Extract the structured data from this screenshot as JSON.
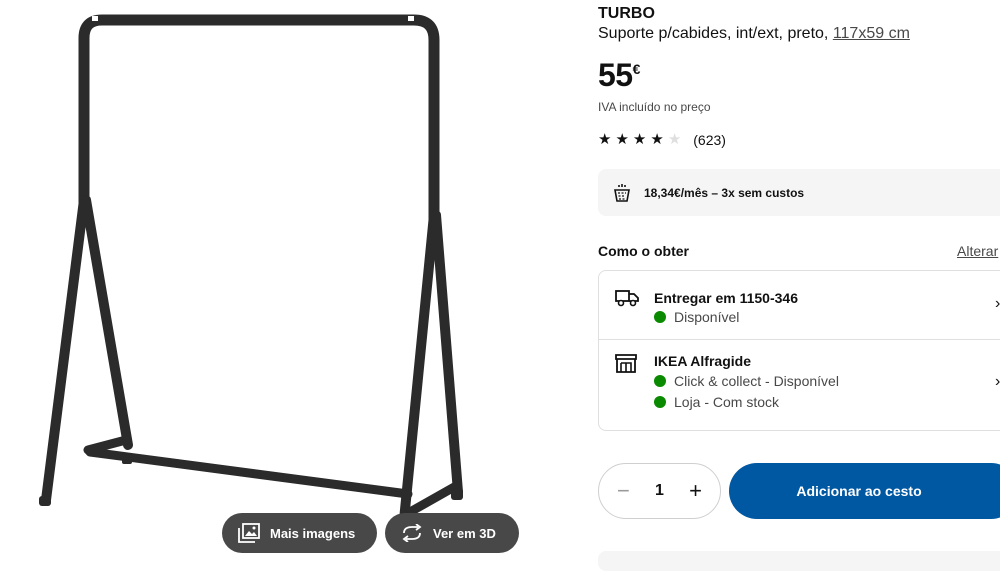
{
  "product": {
    "name": "TURBO",
    "description": "Suporte p/cabides, int/ext, preto,",
    "size_link": "117x59 cm",
    "price_amount": "55",
    "price_currency": "€",
    "vat_note": "IVA incluído no preço",
    "rating": {
      "value": 4,
      "max": 5,
      "count": "(623)"
    }
  },
  "media": {
    "more_images_label": "Mais imagens",
    "view_3d_label": "Ver em 3D",
    "image_color": "#2b2b2b"
  },
  "finance": {
    "text": "18,34€/mês – 3x sem custos"
  },
  "obtain": {
    "title": "Como o obter",
    "change_label": "Alterar",
    "delivery": {
      "title": "Entregar em 1150-346",
      "status": "Disponível"
    },
    "store": {
      "title": "IKEA Alfragide",
      "status_collect": "Click & collect - Disponível",
      "status_stock": "Loja - Com stock"
    }
  },
  "cart": {
    "quantity": "1",
    "add_label": "Adicionar ao cesto"
  },
  "colors": {
    "brand_blue": "#0058a3",
    "available_green": "#0a8a00",
    "panel_gray": "#f5f5f5",
    "button_dark": "#484848"
  },
  "icons": [
    "gallery-icon",
    "rotate-3d-icon",
    "star-icon",
    "installment-icon",
    "truck-icon",
    "store-icon",
    "chevron-right-icon",
    "minus-icon",
    "plus-icon"
  ]
}
